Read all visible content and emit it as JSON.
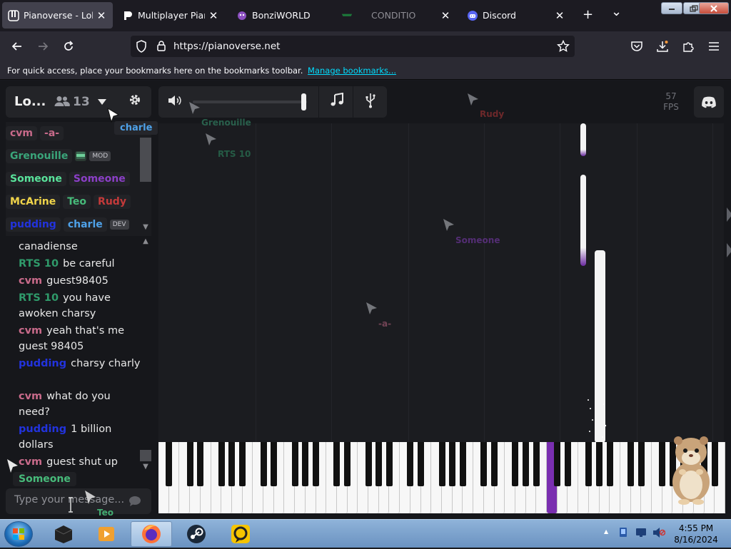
{
  "browser": {
    "tabs": [
      {
        "label": "Pianoverse - Lobby",
        "close": "✕",
        "active": true
      },
      {
        "label": "Multiplayer Piano",
        "close": "✕",
        "active": false
      },
      {
        "label": "BonziWORLD",
        "close": "",
        "active": false
      },
      {
        "label": "CONDITIO",
        "close": "✕",
        "active": false
      },
      {
        "label": "Discord",
        "close": "✕",
        "active": false
      }
    ],
    "new_tab": "+",
    "list_tabs": "⌄",
    "url": "https://pianoverse.net",
    "bookmarks_text": "For quick access, place your bookmarks here on the bookmarks toolbar.",
    "bookmarks_link": "Manage bookmarks..."
  },
  "lobby": {
    "title": "Lo...",
    "user_count": "13",
    "fps_value": "57",
    "fps_label": "FPS"
  },
  "users": [
    [
      {
        "name": "cvm",
        "color": "#c86a8a"
      },
      {
        "name": "-a-",
        "color": "#c86a8a"
      }
    ],
    [
      {
        "name": "Grenouille",
        "color": "#3aa57a",
        "badge": "MOD"
      }
    ],
    [
      {
        "name": "Someone",
        "color": "#59e39b"
      },
      {
        "name": "Someone",
        "color": "#8b3fc7"
      }
    ],
    [
      {
        "name": "McArine",
        "color": "#f0d44a"
      },
      {
        "name": "Teo",
        "color": "#47bb7a"
      },
      {
        "name": "Rudy",
        "color": "#c43a3a"
      }
    ],
    [
      {
        "name": "pudding",
        "color": "#2233dd"
      },
      {
        "name": "charle",
        "color": "#4ea1e8",
        "badge": "DEV"
      }
    ]
  ],
  "tooltip": "charle",
  "chat": [
    {
      "name": "",
      "color": "",
      "text": "canadiense"
    },
    {
      "name": "RTS 10",
      "color": "#2f9a6a",
      "text": "be careful"
    },
    {
      "name": "cvm",
      "color": "#c86a8a",
      "text": "guest98405"
    },
    {
      "name": "RTS 10",
      "color": "#2f9a6a",
      "text": "you have awoken charsy"
    },
    {
      "name": "cvm",
      "color": "#c86a8a",
      "text": "yeah that's me guest 98405"
    },
    {
      "name": "pudding",
      "color": "#2233dd",
      "text": "charsy charly"
    },
    {
      "name": "cvm",
      "color": "#c86a8a",
      "text": "what do you need?"
    },
    {
      "name": "pudding",
      "color": "#2233dd",
      "text": "1 billion dollars"
    },
    {
      "name": "cvm",
      "color": "#c86a8a",
      "text": "guest shut up"
    }
  ],
  "typing": "Someone",
  "chat_placeholder": "Type your message...",
  "cursors": [
    {
      "label": "Grenouille",
      "color": "#3aa57a"
    },
    {
      "label": "RTS 10",
      "color": "#2f9a6a"
    },
    {
      "label": "Rudy",
      "color": "#c43a3a"
    },
    {
      "label": "Someone",
      "color": "#8b3fc7"
    },
    {
      "label": "-a-",
      "color": "#c86a8a"
    },
    {
      "label": "Teo",
      "color": "#47bb7a"
    }
  ],
  "taskbar": {
    "time": "4:55 PM",
    "date": "8/16/2024"
  },
  "colors": {
    "accent_purple": "#7a2fb0",
    "link_cyan": "#00ddff"
  }
}
